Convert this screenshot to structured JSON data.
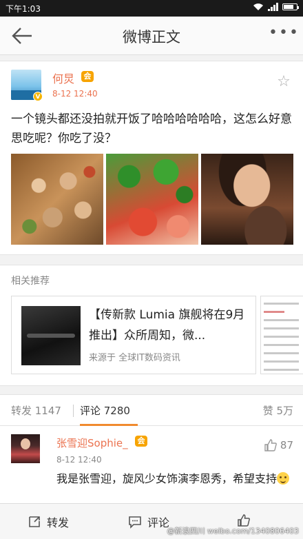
{
  "status_bar": {
    "time": "下午1:03"
  },
  "nav": {
    "title": "微博正文",
    "more": "•••"
  },
  "post": {
    "author": "何炅",
    "badge": "V",
    "level": "会",
    "time": "8-12 12:40",
    "text": "一个镜头都还没拍就开饭了哈哈哈哈哈哈，这怎么好意思吃呢？你吃了没？"
  },
  "recommend": {
    "header": "相关推荐",
    "card_title": "【传新款 Lumia 旗舰将在9月推出】众所周知，微...",
    "card_source": "来源于 全球IT数码资讯"
  },
  "tabs": {
    "repost": "转发 1147",
    "comment": "评论 7280",
    "like": "赞 5万"
  },
  "comment": {
    "name": "张雪迎Sophie_",
    "level": "会",
    "time": "8-12 12:40",
    "likes": "87",
    "text": "我是张雪迎，旋风少女饰演李恩秀，希望支持"
  },
  "bottom_bar": {
    "repost": "转发",
    "comment": "评论"
  },
  "watermark": "@新浪四川  weibo.com/1340806403",
  "colors": {
    "name_orange": "#eb7350",
    "tab_underline": "#f08a2e"
  }
}
